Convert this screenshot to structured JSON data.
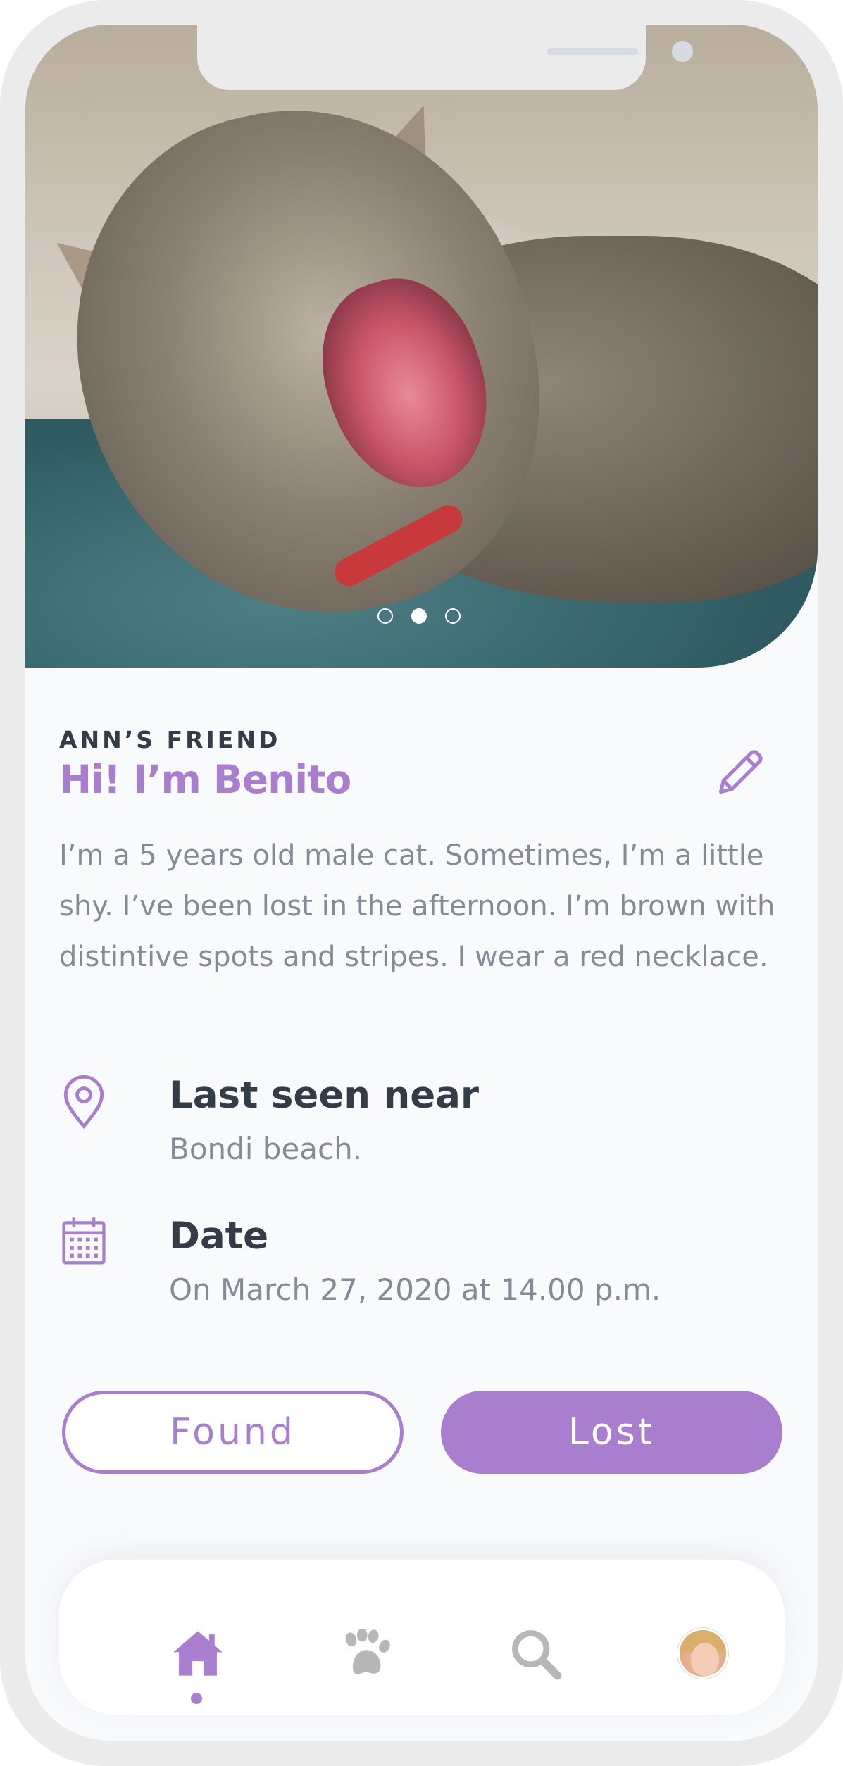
{
  "pet": {
    "eyebrow": "ANN’S FRIEND",
    "title": "Hi! I’m Benito",
    "description": "I’m a 5 years old male cat. Sometimes, I’m a little shy. I’ve been lost in the afternoon. I’m brown with distintive spots and stripes. I wear a red necklace."
  },
  "carousel": {
    "total": 3,
    "active_index": 1
  },
  "location": {
    "heading": "Last seen near",
    "value": "Bondi beach.",
    "icon": "location-pin-icon"
  },
  "date": {
    "heading": "Date",
    "value": "On March 27, 2020 at 14.00 p.m.",
    "icon": "calendar-icon"
  },
  "actions": {
    "found_label": "Found",
    "lost_label": "Lost"
  },
  "nav": {
    "items": [
      "home-icon",
      "paw-icon",
      "search-icon",
      "avatar"
    ],
    "active": "home-icon"
  },
  "colors": {
    "accent": "#aa7ecf",
    "heading": "#333c47",
    "body_text": "#848b94",
    "inactive_icon": "#b7b7b7"
  }
}
